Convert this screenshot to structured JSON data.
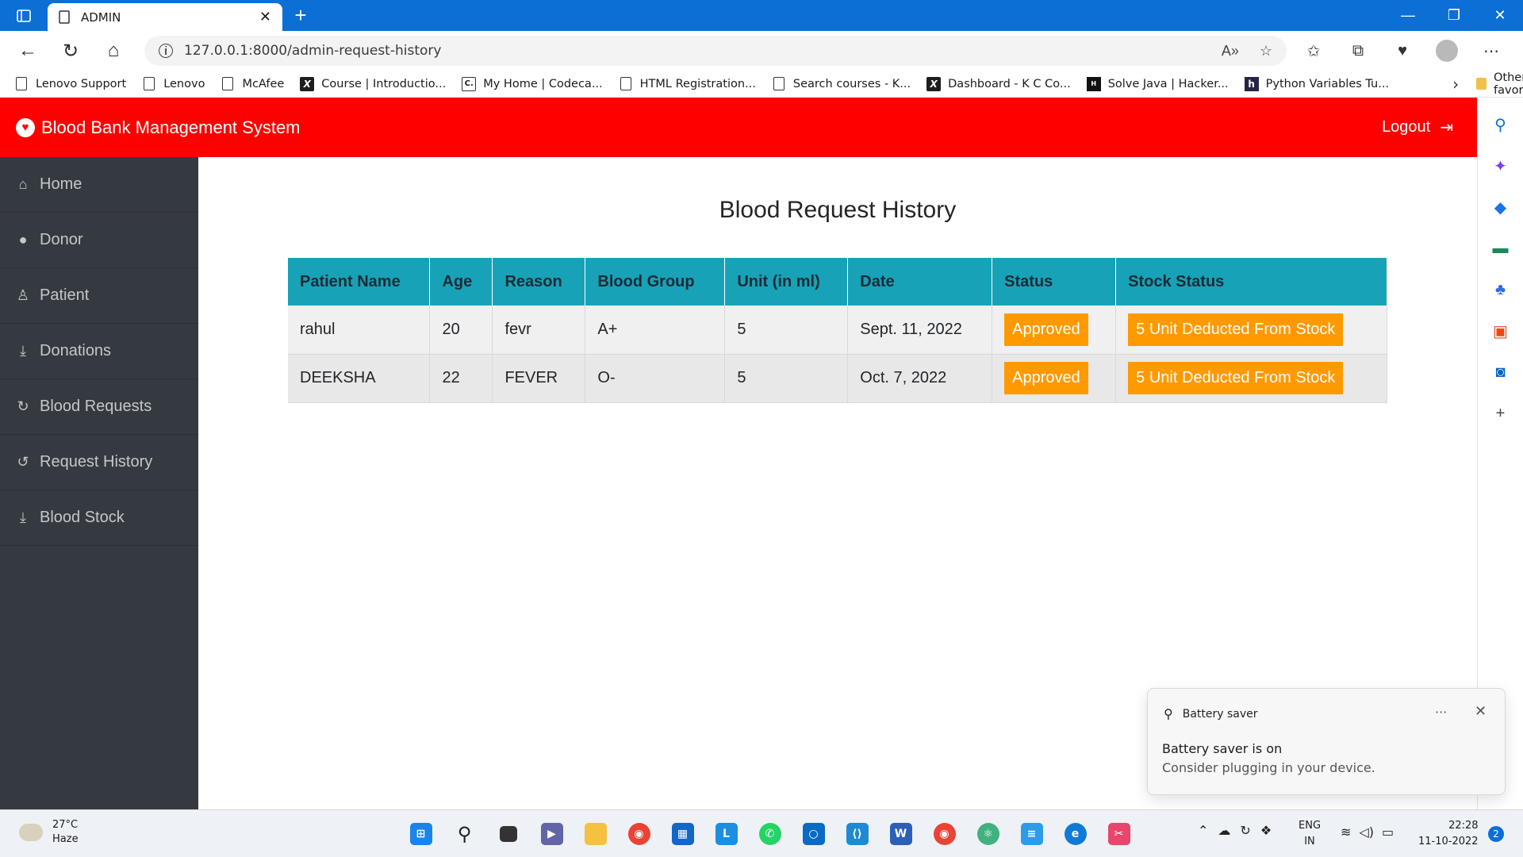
{
  "browser": {
    "tab_title": "ADMIN",
    "url": "127.0.0.1:8000/admin-request-history",
    "favorites": [
      {
        "label": "Lenovo Support",
        "icon": "page-icon"
      },
      {
        "label": "Lenovo",
        "icon": "page-icon"
      },
      {
        "label": "McAfee",
        "icon": "page-icon"
      },
      {
        "label": "Course | Introductio...",
        "icon": "x-logo-icon"
      },
      {
        "label": "My Home | Codeca...",
        "icon": "codecademy-icon"
      },
      {
        "label": "HTML Registration...",
        "icon": "page-icon"
      },
      {
        "label": "Search courses - K...",
        "icon": "page-icon"
      },
      {
        "label": "Dashboard - K C Co...",
        "icon": "x-logo-icon"
      },
      {
        "label": "Solve Java | Hacker...",
        "icon": "hackerrank-icon"
      },
      {
        "label": "Python Variables Tu...",
        "icon": "h-logo-icon"
      }
    ],
    "other_favorites": "Other favorites"
  },
  "app": {
    "brand": "Blood Bank Management System",
    "logout": "Logout",
    "accent_color": "#ff0000",
    "sidebar": [
      {
        "label": "Home",
        "icon": "home-icon"
      },
      {
        "label": "Donor",
        "icon": "user-icon"
      },
      {
        "label": "Patient",
        "icon": "patient-icon"
      },
      {
        "label": "Donations",
        "icon": "donation-icon"
      },
      {
        "label": "Blood Requests",
        "icon": "refresh-icon"
      },
      {
        "label": "Request History",
        "icon": "history-icon"
      },
      {
        "label": "Blood Stock",
        "icon": "stock-icon"
      }
    ]
  },
  "main": {
    "title": "Blood Request History",
    "table": {
      "headers": [
        "Patient Name",
        "Age",
        "Reason",
        "Blood Group",
        "Unit (in ml)",
        "Date",
        "Status",
        "Stock Status"
      ],
      "rows": [
        {
          "patient": "rahul",
          "age": "20",
          "reason": "fevr",
          "group": "A+",
          "unit": "5",
          "date": "Sept. 11, 2022",
          "status": "Approved",
          "stock": "5 Unit Deducted From Stock"
        },
        {
          "patient": "DEEKSHA",
          "age": "22",
          "reason": "FEVER",
          "group": "O-",
          "unit": "5",
          "date": "Oct. 7, 2022",
          "status": "Approved",
          "stock": "5 Unit Deducted From Stock"
        }
      ]
    }
  },
  "toast": {
    "app": "Battery saver",
    "title": "Battery saver is on",
    "body": "Consider plugging in your device."
  },
  "taskbar": {
    "temperature": "27°C",
    "weather": "Haze",
    "lang1": "ENG",
    "lang2": "IN",
    "time": "22:28",
    "date": "11-10-2022",
    "notifications": "2"
  }
}
